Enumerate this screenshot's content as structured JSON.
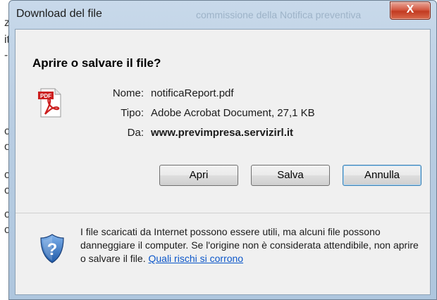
{
  "background_page": {
    "chars": [
      "z",
      "it",
      "-",
      "c",
      "o",
      "c",
      "c",
      "c",
      "c"
    ]
  },
  "window": {
    "title": "Download del file",
    "title_ghost": "commissione della Notifica preventiva",
    "close_label": "X"
  },
  "dialog": {
    "heading": "Aprire o salvare il file?",
    "file": {
      "icon": "pdf-icon",
      "name_label": "Nome:",
      "name_value": "notificaReport.pdf",
      "type_label": "Tipo:",
      "type_value": "Adobe Acrobat Document, 27,1 KB",
      "from_label": "Da:",
      "from_value": "www.previmpresa.servizirl.it"
    },
    "buttons": {
      "open": "Apri",
      "save": "Salva",
      "cancel": "Annulla"
    },
    "warning": {
      "icon": "shield-question-icon",
      "text": "I file scaricati da Internet possono essere utili, ma alcuni file possono danneggiare il computer. Se l'origine non è considerata attendibile, non aprire o salvare il file. ",
      "link": "Quali rischi si corrono"
    }
  },
  "colors": {
    "accent_link": "#0b56c9",
    "close_red": "#c23b21",
    "pdf_red": "#cc1f1f"
  }
}
